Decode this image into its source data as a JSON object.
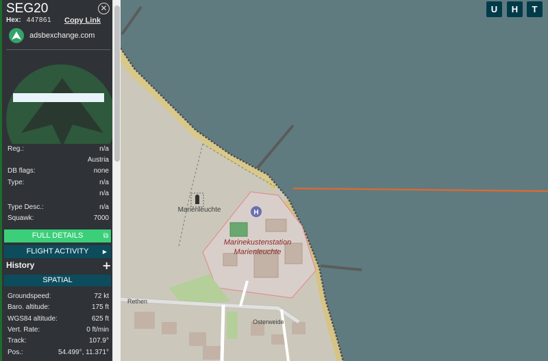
{
  "aircraft": {
    "callsign": "SEG20",
    "hex_label": "Hex:",
    "hex_value": "447861",
    "copy_link": "Copy Link",
    "source_site": "adsbexchange.com"
  },
  "fields": [
    {
      "key": "Reg.:",
      "value": "n/a"
    },
    {
      "key": "",
      "value": "Austria"
    },
    {
      "key": "DB flags:",
      "value": "none"
    },
    {
      "key": "Type:",
      "value": "n/a"
    },
    {
      "key": "",
      "value": "n/a"
    },
    {
      "key": "Type Desc.:",
      "value": "n/a"
    },
    {
      "key": "Squawk:",
      "value": "7000"
    }
  ],
  "buttons": {
    "full_details": "FULL DETAILS",
    "flight_activity": "FLIGHT ACTIVITY",
    "history": "History",
    "spatial": "SPATIAL"
  },
  "spatial": [
    {
      "key": "Groundspeed:",
      "value": "72 kt"
    },
    {
      "key": "Baro. altitude:",
      "value": "175 ft"
    },
    {
      "key": "WGS84 altitude:",
      "value": "625 ft"
    },
    {
      "key": "Vert. Rate:",
      "value": "0 ft/min"
    },
    {
      "key": "Track:",
      "value": "107.9°"
    },
    {
      "key": "Pos.:",
      "value": "54.499°, 11.371°"
    }
  ],
  "map": {
    "buttons": [
      "U",
      "H",
      "T"
    ],
    "labels": {
      "lighthouse": "Marienleuchte",
      "station_line1": "Marinekustenstation",
      "station_line2": "Marienleuchte",
      "street_rethen": "Rethen",
      "street_osterweide": "Osterweide"
    },
    "colors": {
      "water": "#5f7b80",
      "land": "#c9c6b8",
      "beach": "#d8c98a",
      "track": "#e2682e",
      "station_label": "#8a2a2a"
    }
  },
  "icons": {
    "close": "close-icon",
    "external": "external-link-icon",
    "arrow": "arrow-right-icon",
    "plus": "plus-icon",
    "logo": "adsbexchange-logo-icon",
    "lighthouse": "lighthouse-icon",
    "helipad": "helipad-icon"
  }
}
